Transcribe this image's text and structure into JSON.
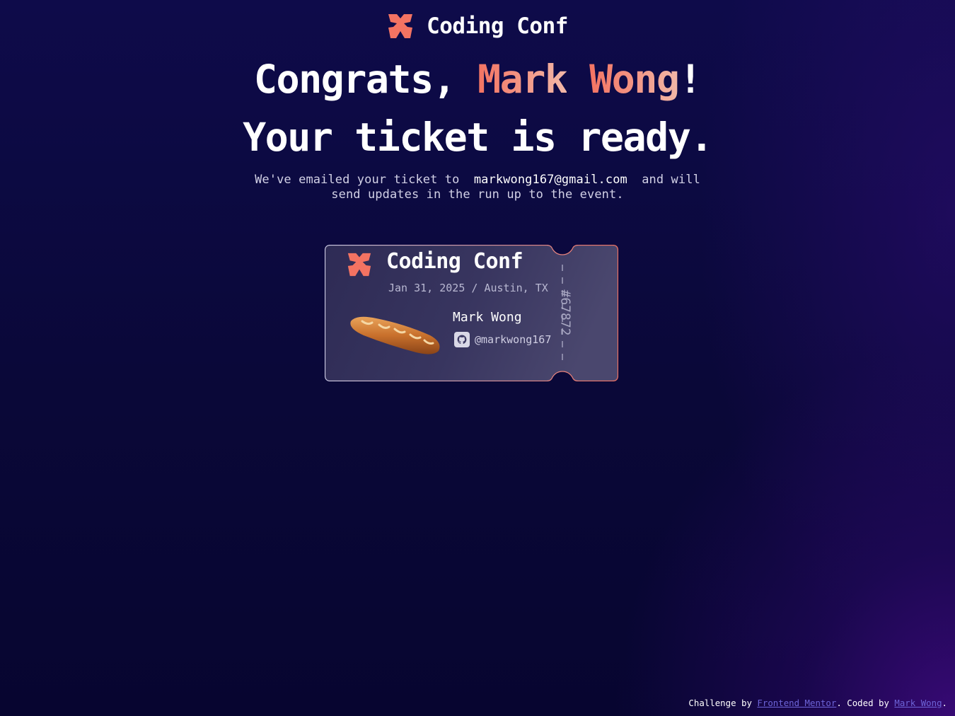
{
  "header": {
    "logo_text": "Coding Conf"
  },
  "hero": {
    "greeting_prefix": "Congrats, ",
    "first_name": "Mark",
    "last_name": "Wong",
    "greeting_suffix": "!",
    "title_line2": "Your ticket is ready.",
    "sub_prefix": "We've emailed your ticket to",
    "email": "markwong167@gmail.com",
    "sub_suffix": "and will send updates in the run up to the event."
  },
  "ticket": {
    "event_name": "Coding Conf",
    "date_location": "Jan 31, 2025 / Austin, TX",
    "attendee_name": "Mark Wong",
    "github_username": "@markwong167",
    "ticket_number": "#67872"
  },
  "footer": {
    "challenge_prefix": "Challenge by",
    "challenge_link": "Frontend Mentor",
    "coded_prefix": ". Coded by",
    "coded_link": "Mark Wong",
    "end": "."
  },
  "colors": {
    "accent_orange": "#f37362",
    "accent_pink": "#f2b8a8",
    "background": "#0a0838",
    "link": "#6d64d8"
  },
  "icons": {
    "logo": "coding-conf-logo-icon",
    "github": "github-icon",
    "avatar": "baguette-avatar"
  }
}
